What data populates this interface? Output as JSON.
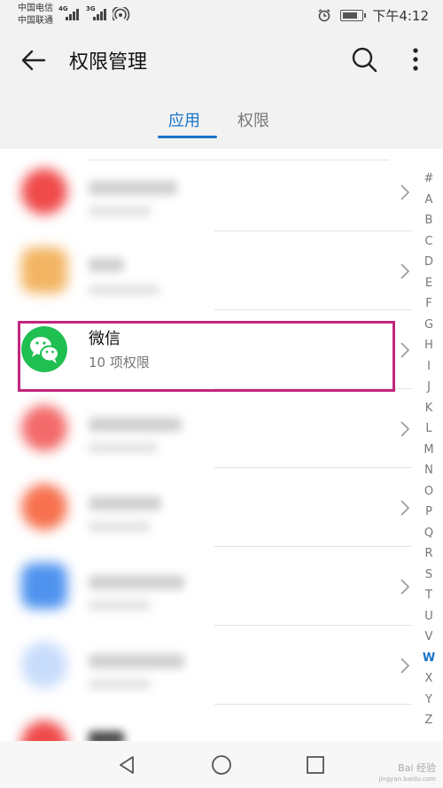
{
  "status_bar": {
    "carrier_1": "中国电信",
    "carrier_2": "中国联通",
    "network_1": "4G",
    "network_2": "3G",
    "time": "下午4:12",
    "battery_level": 0.85
  },
  "header": {
    "title": "权限管理"
  },
  "tabs": [
    {
      "label": "应用",
      "active": true
    },
    {
      "label": "权限",
      "active": false
    }
  ],
  "highlighted_app": {
    "name": "微信",
    "permissions": "10 项权限"
  },
  "index_letters": [
    "#",
    "A",
    "B",
    "C",
    "D",
    "E",
    "F",
    "G",
    "H",
    "I",
    "J",
    "K",
    "L",
    "M",
    "N",
    "O",
    "P",
    "Q",
    "R",
    "S",
    "T",
    "U",
    "V",
    "W",
    "X",
    "Y",
    "Z"
  ],
  "index_active": "W",
  "watermark": {
    "brand": "Bai 经验",
    "url": "jingyan.baidu.com"
  },
  "colors": {
    "accent": "#1775c8",
    "highlight_border": "#c2267e",
    "wechat_green": "#1fbf52"
  }
}
